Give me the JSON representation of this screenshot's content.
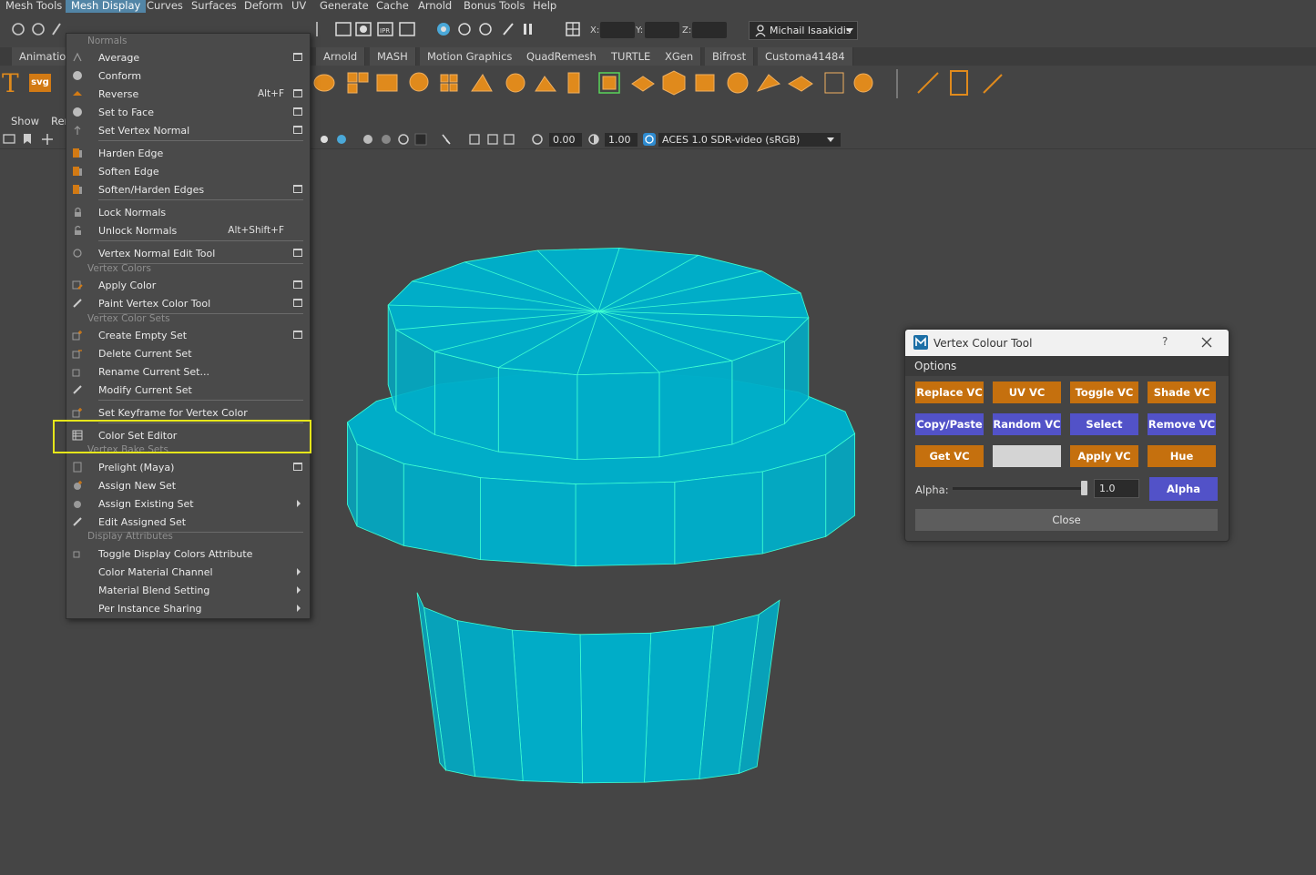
{
  "menubar": {
    "items": [
      "Mesh Tools",
      "Mesh Display",
      "Curves",
      "Surfaces",
      "Deform",
      "UV",
      "Generate",
      "Cache",
      "Arnold",
      "Bonus Tools",
      "Help"
    ],
    "active": "Mesh Display"
  },
  "statusline": {
    "x_label": "X:",
    "y_label": "Y:",
    "z_label": "Z:",
    "user": "Michail Isaakidis"
  },
  "shelf_tabs": [
    "Animation",
    "Arnold",
    "MASH",
    "Motion Graphics",
    "QuadRemesh",
    "TURTLE",
    "XGen",
    "Bifrost",
    "Customa41484"
  ],
  "shelf": {
    "text_icon": "T",
    "svg_icon": "svg"
  },
  "panel_menu": {
    "show": "Show",
    "renderer": "Rer"
  },
  "panel_toolbar": {
    "exposure": "0.00",
    "gamma": "1.00",
    "color_space": "ACES 1.0 SDR-video (sRGB)"
  },
  "menu": {
    "sections": {
      "normals": "Normals",
      "vertex_colors": "Vertex Colors",
      "vertex_color_sets": "Vertex Color Sets",
      "vertex_bake_sets": "Vertex Bake Sets",
      "display_attributes": "Display Attributes"
    },
    "items": {
      "average": "Average",
      "conform": "Conform",
      "reverse": "Reverse",
      "reverse_sc": "Alt+F",
      "set_to_face": "Set to Face",
      "set_vertex_normal": "Set Vertex Normal",
      "harden_edge": "Harden Edge",
      "soften_edge": "Soften Edge",
      "soften_harden": "Soften/Harden Edges",
      "lock_normals": "Lock Normals",
      "unlock_normals": "Unlock Normals",
      "unlock_sc": "Alt+Shift+F",
      "vn_edit_tool": "Vertex Normal Edit Tool",
      "apply_color": "Apply Color",
      "paint_vc_tool": "Paint Vertex Color Tool",
      "create_empty_set": "Create Empty Set",
      "delete_current_set": "Delete Current Set",
      "rename_current_set": "Rename Current Set...",
      "modify_current_set": "Modify Current Set",
      "set_keyframe_vc": "Set Keyframe for Vertex Color",
      "color_set_editor": "Color Set Editor",
      "prelight": "Prelight (Maya)",
      "assign_new_set": "Assign New Set",
      "assign_existing_set": "Assign Existing Set",
      "edit_assigned_set": "Edit Assigned Set",
      "toggle_display_colors": "Toggle Display Colors Attribute",
      "color_material_channel": "Color Material Channel",
      "material_blend_setting": "Material Blend Setting",
      "per_instance_sharing": "Per Instance Sharing"
    }
  },
  "dialog": {
    "title": "Vertex Colour Tool",
    "help": "?",
    "options": "Options",
    "buttons": {
      "replace_vc": "Replace VC",
      "uv_vc": "UV VC",
      "toggle_vc": "Toggle VC",
      "shade_vc": "Shade VC",
      "copy_paste": "Copy/Paste",
      "random_vc": "Random VC",
      "select": "Select",
      "remove_vc": "Remove VC",
      "get_vc": "Get VC",
      "apply_vc": "Apply VC",
      "hue": "Hue",
      "alpha": "Alpha",
      "close": "Close"
    },
    "alpha_label": "Alpha:",
    "alpha_value": "1.0",
    "alpha_level": 0.97,
    "swatch_color": "#d4d4d4",
    "colors": {
      "orange": "#c5700e",
      "purple": "#5252c8"
    }
  },
  "mesh": {
    "fill": "#00adc8",
    "wire": "#3fffd2"
  }
}
